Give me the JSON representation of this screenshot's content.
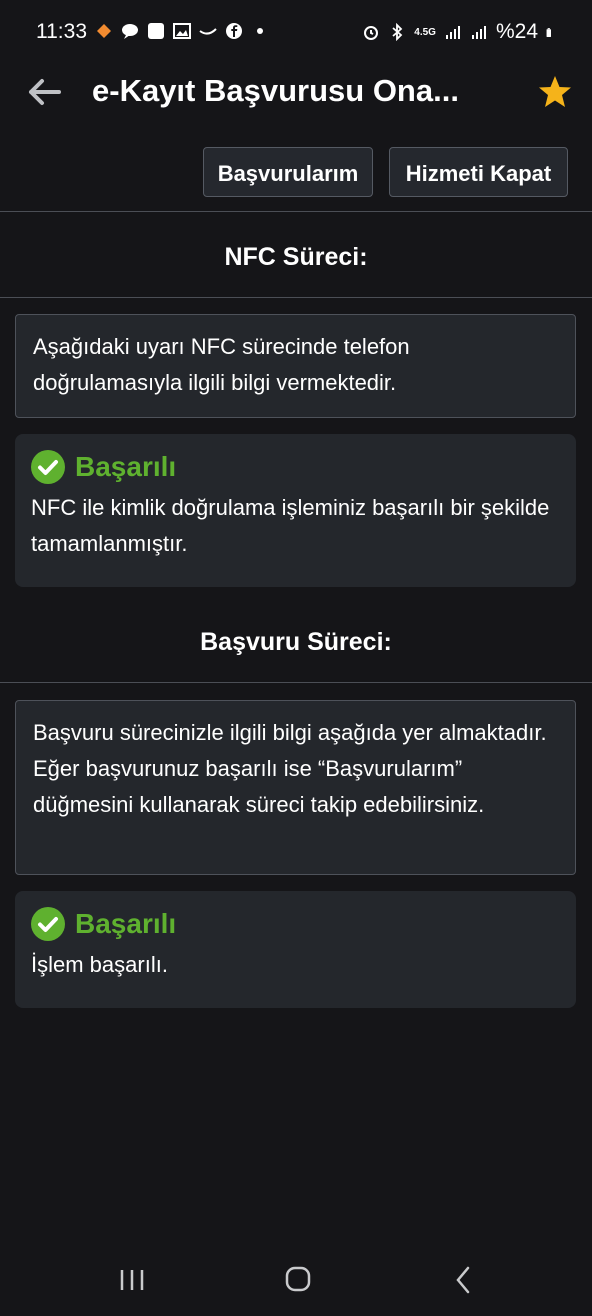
{
  "status_bar": {
    "time": "11:33",
    "battery": "%24",
    "network": "4.5G",
    "left_icons": [
      "bell-icon",
      "chat-icon",
      "app-icon",
      "image-icon",
      "wave-icon",
      "facebook-icon",
      "dot-icon"
    ],
    "right_icons": [
      "alarm-icon",
      "bluetooth-icon",
      "signal-icon",
      "signal-icon",
      "battery-icon"
    ]
  },
  "appbar": {
    "title": "e-Kayıt Başvurusu Ona...",
    "back_icon": "arrow-left-icon",
    "star_icon": "star-icon",
    "star_color": "#f5b31a"
  },
  "actions": {
    "applications_label": "Başvurularım",
    "close_service_label": "Hizmeti Kapat"
  },
  "nfc_section": {
    "title": "NFC Süreci:",
    "info": "Aşağıdaki uyarı NFC sürecinde telefon doğrulamasıyla ilgili bilgi vermektedir.",
    "success_title": "Başarılı",
    "success_text": "NFC ile kimlik doğrulama işleminiz başarılı bir şekilde tamamlanmıştır."
  },
  "application_section": {
    "title": "Başvuru Süreci:",
    "info": "Başvuru sürecinizle ilgili bilgi aşağıda yer almaktadır. Eğer başvurunuz başarılı ise “Başvurularım” düğmesini kullanarak süreci takip edebilirsiniz.",
    "success_title": "Başarılı",
    "success_text": "İşlem başarılı."
  },
  "colors": {
    "background": "#151518",
    "card": "#24272c",
    "success_green": "#5fb12f"
  },
  "navbar": {
    "icons": [
      "recent-apps-icon",
      "home-icon",
      "back-icon"
    ]
  }
}
